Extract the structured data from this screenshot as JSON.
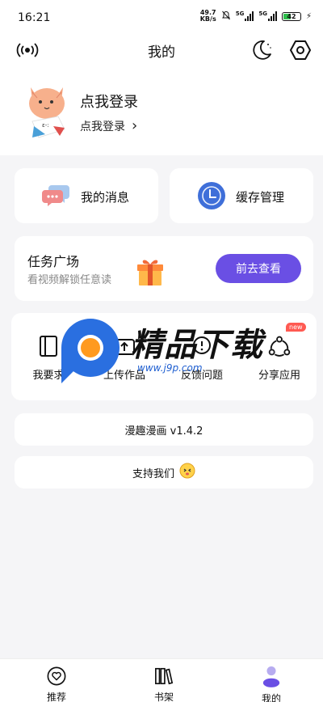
{
  "status_bar": {
    "time": "16:21",
    "net_speed_value": "49.7",
    "net_speed_unit": "KB/s",
    "signal1_label": "5G",
    "signal2_label": "5G",
    "battery": "42"
  },
  "header": {
    "title": "我的"
  },
  "profile": {
    "login_title": "点我登录",
    "login_sub": "点我登录",
    "chevron": "›"
  },
  "quick_actions": {
    "messages_label": "我的消息",
    "cache_label": "缓存管理"
  },
  "task": {
    "title": "任务广场",
    "subtitle": "看视频解锁任意读",
    "button_label": "前去查看"
  },
  "tools": {
    "items": [
      {
        "label": "我要求"
      },
      {
        "label": "上传作品"
      },
      {
        "label": "反馈问题"
      },
      {
        "label": "分享应用",
        "badge": "new"
      }
    ]
  },
  "watermark": {
    "text": "精品下载",
    "url": "www.j9p.com"
  },
  "version": {
    "label": "漫趣漫画 v1.4.2"
  },
  "support": {
    "label": "支持我们"
  },
  "bottom_nav": {
    "items": [
      {
        "label": "推荐"
      },
      {
        "label": "书架"
      },
      {
        "label": "我的"
      }
    ]
  },
  "colors": {
    "accent": "#6a4fe4",
    "badge": "#ff5a52",
    "cache_icon": "#3f6fd9",
    "message_icon": "#f08a8a"
  }
}
